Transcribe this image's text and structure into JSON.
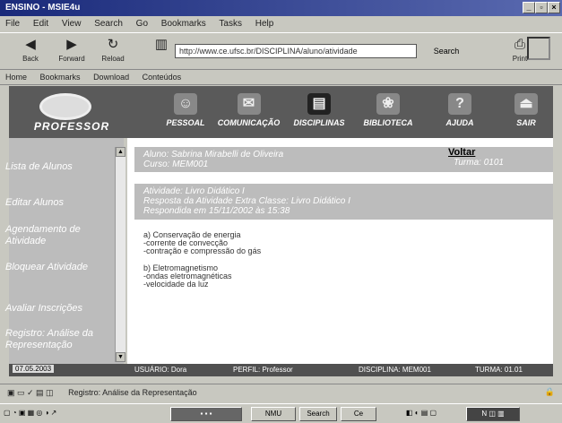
{
  "window": {
    "title": "ENSINO - MSIE4u",
    "min": "_",
    "max": "▫",
    "close": "×"
  },
  "menu": [
    "File",
    "Edit",
    "View",
    "Search",
    "Go",
    "Bookmarks",
    "Tasks",
    "Help"
  ],
  "toolbar": {
    "back": "Back",
    "forward": "Forward",
    "reload": "Reload",
    "address": "http://www.ce.ufsc.br/DISCIPLINA/aluno/atividade",
    "search": "Search",
    "print": "Print"
  },
  "links": [
    "Home",
    "Bookmarks",
    "Download",
    "Conteúdos"
  ],
  "header": {
    "logo": "PROFESSOR",
    "nav": [
      "PESSOAL",
      "COMUNICAÇÃO",
      "DISCIPLINAS",
      "BIBLIOTECA",
      "AJUDA",
      "SAIR"
    ]
  },
  "sidebar": [
    "Lista de Alunos",
    "Editar Alunos",
    "Agendamento de Atividade",
    "Bloquear Atividade",
    "Avaliar Inscrições",
    "Registro: Análise da Representação"
  ],
  "info": {
    "aluno": "Aluno: Sabrina Mirabelli de Oliveira",
    "curso": "Curso: MEM001",
    "voltar": "Voltar",
    "turma": "Turma: 0101"
  },
  "activity": {
    "line1": "Atividade: Livro Didático I",
    "line2": "Resposta da Atividade Extra Classe: Livro Didático I",
    "line3": "Respondida em 15/11/2002 às 15:38"
  },
  "answer": {
    "a": [
      "a) Conservação de energia",
      "-corrente de convecção",
      "-contração e compressão do gás"
    ],
    "b": [
      "b) Eletromagnetismo",
      "-ondas eletromagnéticas",
      "-velocidade da luz"
    ]
  },
  "infobar": {
    "date": "07.05.2003",
    "usuario": "USUÁRIO: Dora",
    "perfil": "PERFIL: Professor",
    "disciplina": "DISCIPLINA: MEM001",
    "turma": "TURMA: 01.01"
  },
  "status": {
    "text": "Registro: Análise da Representação"
  },
  "taskbar": [
    "NMU",
    "Search",
    "Ce"
  ]
}
